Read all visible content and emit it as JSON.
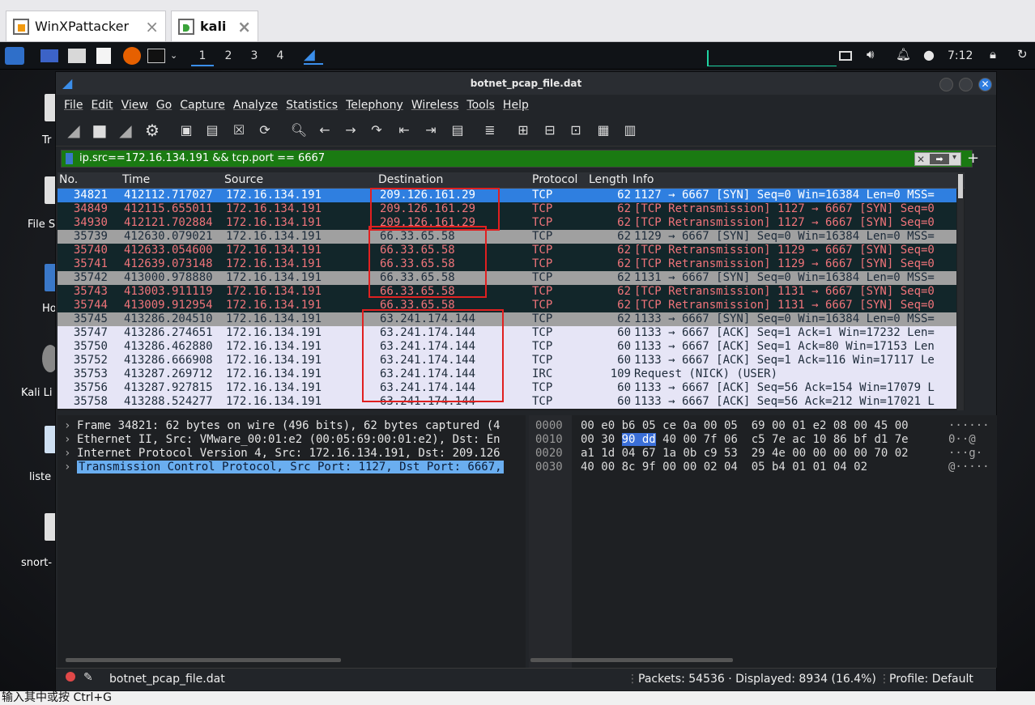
{
  "vm_tabs": [
    {
      "label": "WinXPattacker",
      "close": "×"
    },
    {
      "label": "kali",
      "close": "×"
    }
  ],
  "taskbar": {
    "workspaces": [
      "1",
      "2",
      "3",
      "4"
    ],
    "clock": "7:12"
  },
  "desktop": {
    "labels": [
      "Tr",
      "File S",
      "Ho",
      "Kali Li",
      "liste",
      "snort-"
    ]
  },
  "window": {
    "title": "botnet_pcap_file.dat",
    "menu": [
      "File",
      "Edit",
      "View",
      "Go",
      "Capture",
      "Analyze",
      "Statistics",
      "Telephony",
      "Wireless",
      "Tools",
      "Help"
    ]
  },
  "filter": {
    "value": "ip.src==172.16.134.191 && tcp.port == 6667",
    "add": "+"
  },
  "columns": [
    "No.",
    "Time",
    "Source",
    "Destination",
    "Protocol",
    "Length",
    "Info"
  ],
  "packets": [
    {
      "no": "34821",
      "time": "412112.717027",
      "src": "172.16.134.191",
      "dst": "209.126.161.29",
      "proto": "TCP",
      "len": "62",
      "info": "1127 → 6667 [SYN] Seq=0 Win=16384 Len=0 MSS=",
      "style": "selected"
    },
    {
      "no": "34849",
      "time": "412115.655011",
      "src": "172.16.134.191",
      "dst": "209.126.161.29",
      "proto": "TCP",
      "len": "62",
      "info": "[TCP Retransmission] 1127 → 6667 [SYN] Seq=0",
      "style": "bad"
    },
    {
      "no": "34930",
      "time": "412121.702884",
      "src": "172.16.134.191",
      "dst": "209.126.161.29",
      "proto": "TCP",
      "len": "62",
      "info": "[TCP Retransmission] 1127 → 6667 [SYN] Seq=0",
      "style": "bad"
    },
    {
      "no": "35739",
      "time": "412630.079021",
      "src": "172.16.134.191",
      "dst": "66.33.65.58",
      "proto": "TCP",
      "len": "62",
      "info": "1129 → 6667 [SYN] Seq=0 Win=16384 Len=0 MSS=",
      "style": "syn"
    },
    {
      "no": "35740",
      "time": "412633.054600",
      "src": "172.16.134.191",
      "dst": "66.33.65.58",
      "proto": "TCP",
      "len": "62",
      "info": "[TCP Retransmission] 1129 → 6667 [SYN] Seq=0",
      "style": "bad"
    },
    {
      "no": "35741",
      "time": "412639.073148",
      "src": "172.16.134.191",
      "dst": "66.33.65.58",
      "proto": "TCP",
      "len": "62",
      "info": "[TCP Retransmission] 1129 → 6667 [SYN] Seq=0",
      "style": "bad"
    },
    {
      "no": "35742",
      "time": "413000.978880",
      "src": "172.16.134.191",
      "dst": "66.33.65.58",
      "proto": "TCP",
      "len": "62",
      "info": "1131 → 6667 [SYN] Seq=0 Win=16384 Len=0 MSS=",
      "style": "syn"
    },
    {
      "no": "35743",
      "time": "413003.911119",
      "src": "172.16.134.191",
      "dst": "66.33.65.58",
      "proto": "TCP",
      "len": "62",
      "info": "[TCP Retransmission] 1131 → 6667 [SYN] Seq=0",
      "style": "bad"
    },
    {
      "no": "35744",
      "time": "413009.912954",
      "src": "172.16.134.191",
      "dst": "66.33.65.58",
      "proto": "TCP",
      "len": "62",
      "info": "[TCP Retransmission] 1131 → 6667 [SYN] Seq=0",
      "style": "bad"
    },
    {
      "no": "35745",
      "time": "413286.204510",
      "src": "172.16.134.191",
      "dst": "63.241.174.144",
      "proto": "TCP",
      "len": "62",
      "info": "1133 → 6667 [SYN] Seq=0 Win=16384 Len=0 MSS=",
      "style": "syn"
    },
    {
      "no": "35747",
      "time": "413286.274651",
      "src": "172.16.134.191",
      "dst": "63.241.174.144",
      "proto": "TCP",
      "len": "60",
      "info": "1133 → 6667 [ACK] Seq=1 Ack=1 Win=17232 Len=",
      "style": "ok"
    },
    {
      "no": "35750",
      "time": "413286.462880",
      "src": "172.16.134.191",
      "dst": "63.241.174.144",
      "proto": "TCP",
      "len": "60",
      "info": "1133 → 6667 [ACK] Seq=1 Ack=80 Win=17153 Len",
      "style": "ok"
    },
    {
      "no": "35752",
      "time": "413286.666908",
      "src": "172.16.134.191",
      "dst": "63.241.174.144",
      "proto": "TCP",
      "len": "60",
      "info": "1133 → 6667 [ACK] Seq=1 Ack=116 Win=17117 Le",
      "style": "ok"
    },
    {
      "no": "35753",
      "time": "413287.269712",
      "src": "172.16.134.191",
      "dst": "63.241.174.144",
      "proto": "IRC",
      "len": "109",
      "info": "Request (NICK) (USER)",
      "style": "ok"
    },
    {
      "no": "35756",
      "time": "413287.927815",
      "src": "172.16.134.191",
      "dst": "63.241.174.144",
      "proto": "TCP",
      "len": "60",
      "info": "1133 → 6667 [ACK] Seq=56 Ack=154 Win=17079 L",
      "style": "ok"
    },
    {
      "no": "35758",
      "time": "413288.524277",
      "src": "172.16.134.191",
      "dst": "63.241.174.144",
      "proto": "TCP",
      "len": "60",
      "info": "1133 → 6667 [ACK] Seq=56 Ack=212 Win=17021 L",
      "style": "ok"
    }
  ],
  "details": [
    "Frame 34821: 62 bytes on wire (496 bits), 62 bytes captured (4",
    "Ethernet II, Src: VMware_00:01:e2 (00:05:69:00:01:e2), Dst: En",
    "Internet Protocol Version 4, Src: 172.16.134.191, Dst: 209.126",
    "Transmission Control Protocol, Src Port: 1127, Dst Port: 6667,"
  ],
  "bytes": [
    {
      "off": "0000",
      "pre": "00 e0 b6 05 ce 0a 00 05  69 00 01 e2 08 00 45 00",
      "hl": "",
      "post": "",
      "ascii": "······"
    },
    {
      "off": "0010",
      "pre": "00 30 ",
      "hl": "90 dd",
      "post": " 40 00 7f 06  c5 7e ac 10 86 bf d1 7e",
      "ascii": "0··@"
    },
    {
      "off": "0020",
      "pre": "a1 1d 04 67 1a 0b c9 53  29 4e 00 00 00 00 70 02",
      "hl": "",
      "post": "",
      "ascii": "···g·"
    },
    {
      "off": "0030",
      "pre": "40 00 8c 9f 00 00 02 04  05 b4 01 01 04 02",
      "hl": "",
      "post": "",
      "ascii": "@·····"
    }
  ],
  "status": {
    "file": "botnet_pcap_file.dat",
    "packets": "Packets: 54536 · Displayed: 8934 (16.4%)",
    "profile": "Profile: Default"
  },
  "bottom_strip": "输入其中或按 Ctrl+G"
}
